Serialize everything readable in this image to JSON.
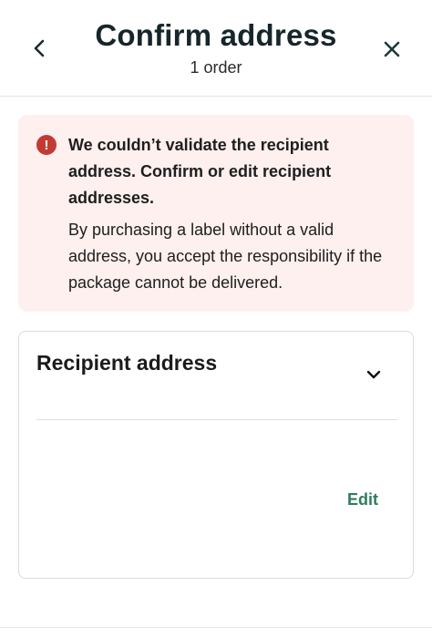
{
  "header": {
    "title": "Confirm address",
    "subtitle": "1 order",
    "back_icon": "chevron-left-icon",
    "close_icon": "close-icon"
  },
  "alert": {
    "icon": "alert-circle-icon",
    "icon_glyph": "!",
    "color": "#c23b33",
    "background": "#fdf0ee",
    "heading": "We couldn’t validate the recipient address. Confirm or edit recipient addresses.",
    "body": "By purchasing a label without a valid address, you accept the responsibility if the package cannot be delivered."
  },
  "recipient_card": {
    "title": "Recipient address",
    "toggle_icon": "chevron-down-icon",
    "edit_label": "Edit",
    "accent": "#2e7d5b"
  }
}
